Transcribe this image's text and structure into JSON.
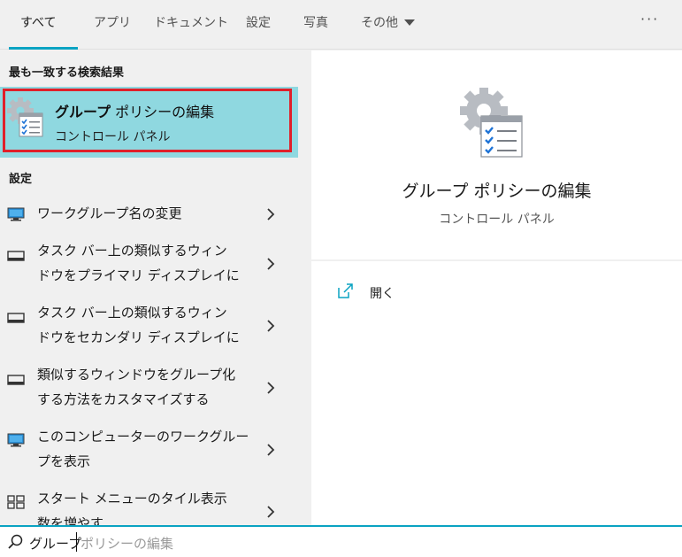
{
  "tabs": [
    {
      "label": "すべて"
    },
    {
      "label": "アプリ"
    },
    {
      "label": "ドキュメント"
    },
    {
      "label": "設定"
    },
    {
      "label": "写真"
    },
    {
      "label": "その他"
    }
  ],
  "more_label": "···",
  "best_match": {
    "section_label": "最も一致する検索結果",
    "title_bold": "グループ",
    "title_rest": " ポリシーの編集",
    "subtitle": "コントロール パネル",
    "icon": "group-policy-gear-icon"
  },
  "settings": {
    "section_label": "設定",
    "items": [
      {
        "line1": "ワークグループ名の変更",
        "line2": "",
        "icon": "monitor-icon"
      },
      {
        "line1": "タスク バー上の類似するウィン",
        "line2": "ドウをプライマリ ディスプレイに",
        "icon": "taskbar-icon"
      },
      {
        "line1": "タスク バー上の類似するウィン",
        "line2": "ドウをセカンダリ ディスプレイに",
        "icon": "taskbar-icon"
      },
      {
        "line1": "類似するウィンドウをグループ化",
        "line2": "する方法をカスタマイズする",
        "icon": "taskbar-icon"
      },
      {
        "line1": "このコンピューターのワークグルー",
        "line2": "プを表示",
        "icon": "monitor-icon"
      },
      {
        "line1": "スタート メニューのタイル表示",
        "line2": "数を増やす",
        "icon": "tiles-icon"
      }
    ]
  },
  "preview": {
    "title": "グループ ポリシーの編集",
    "subtitle": "コントロール パネル",
    "open_label": "開く"
  },
  "search": {
    "typed": "グループ",
    "suggestion": "ポリシーの編集"
  },
  "colors": {
    "accent": "#0aa3c2",
    "highlight": "#8fd8e0",
    "selection_border": "#e0202a"
  }
}
